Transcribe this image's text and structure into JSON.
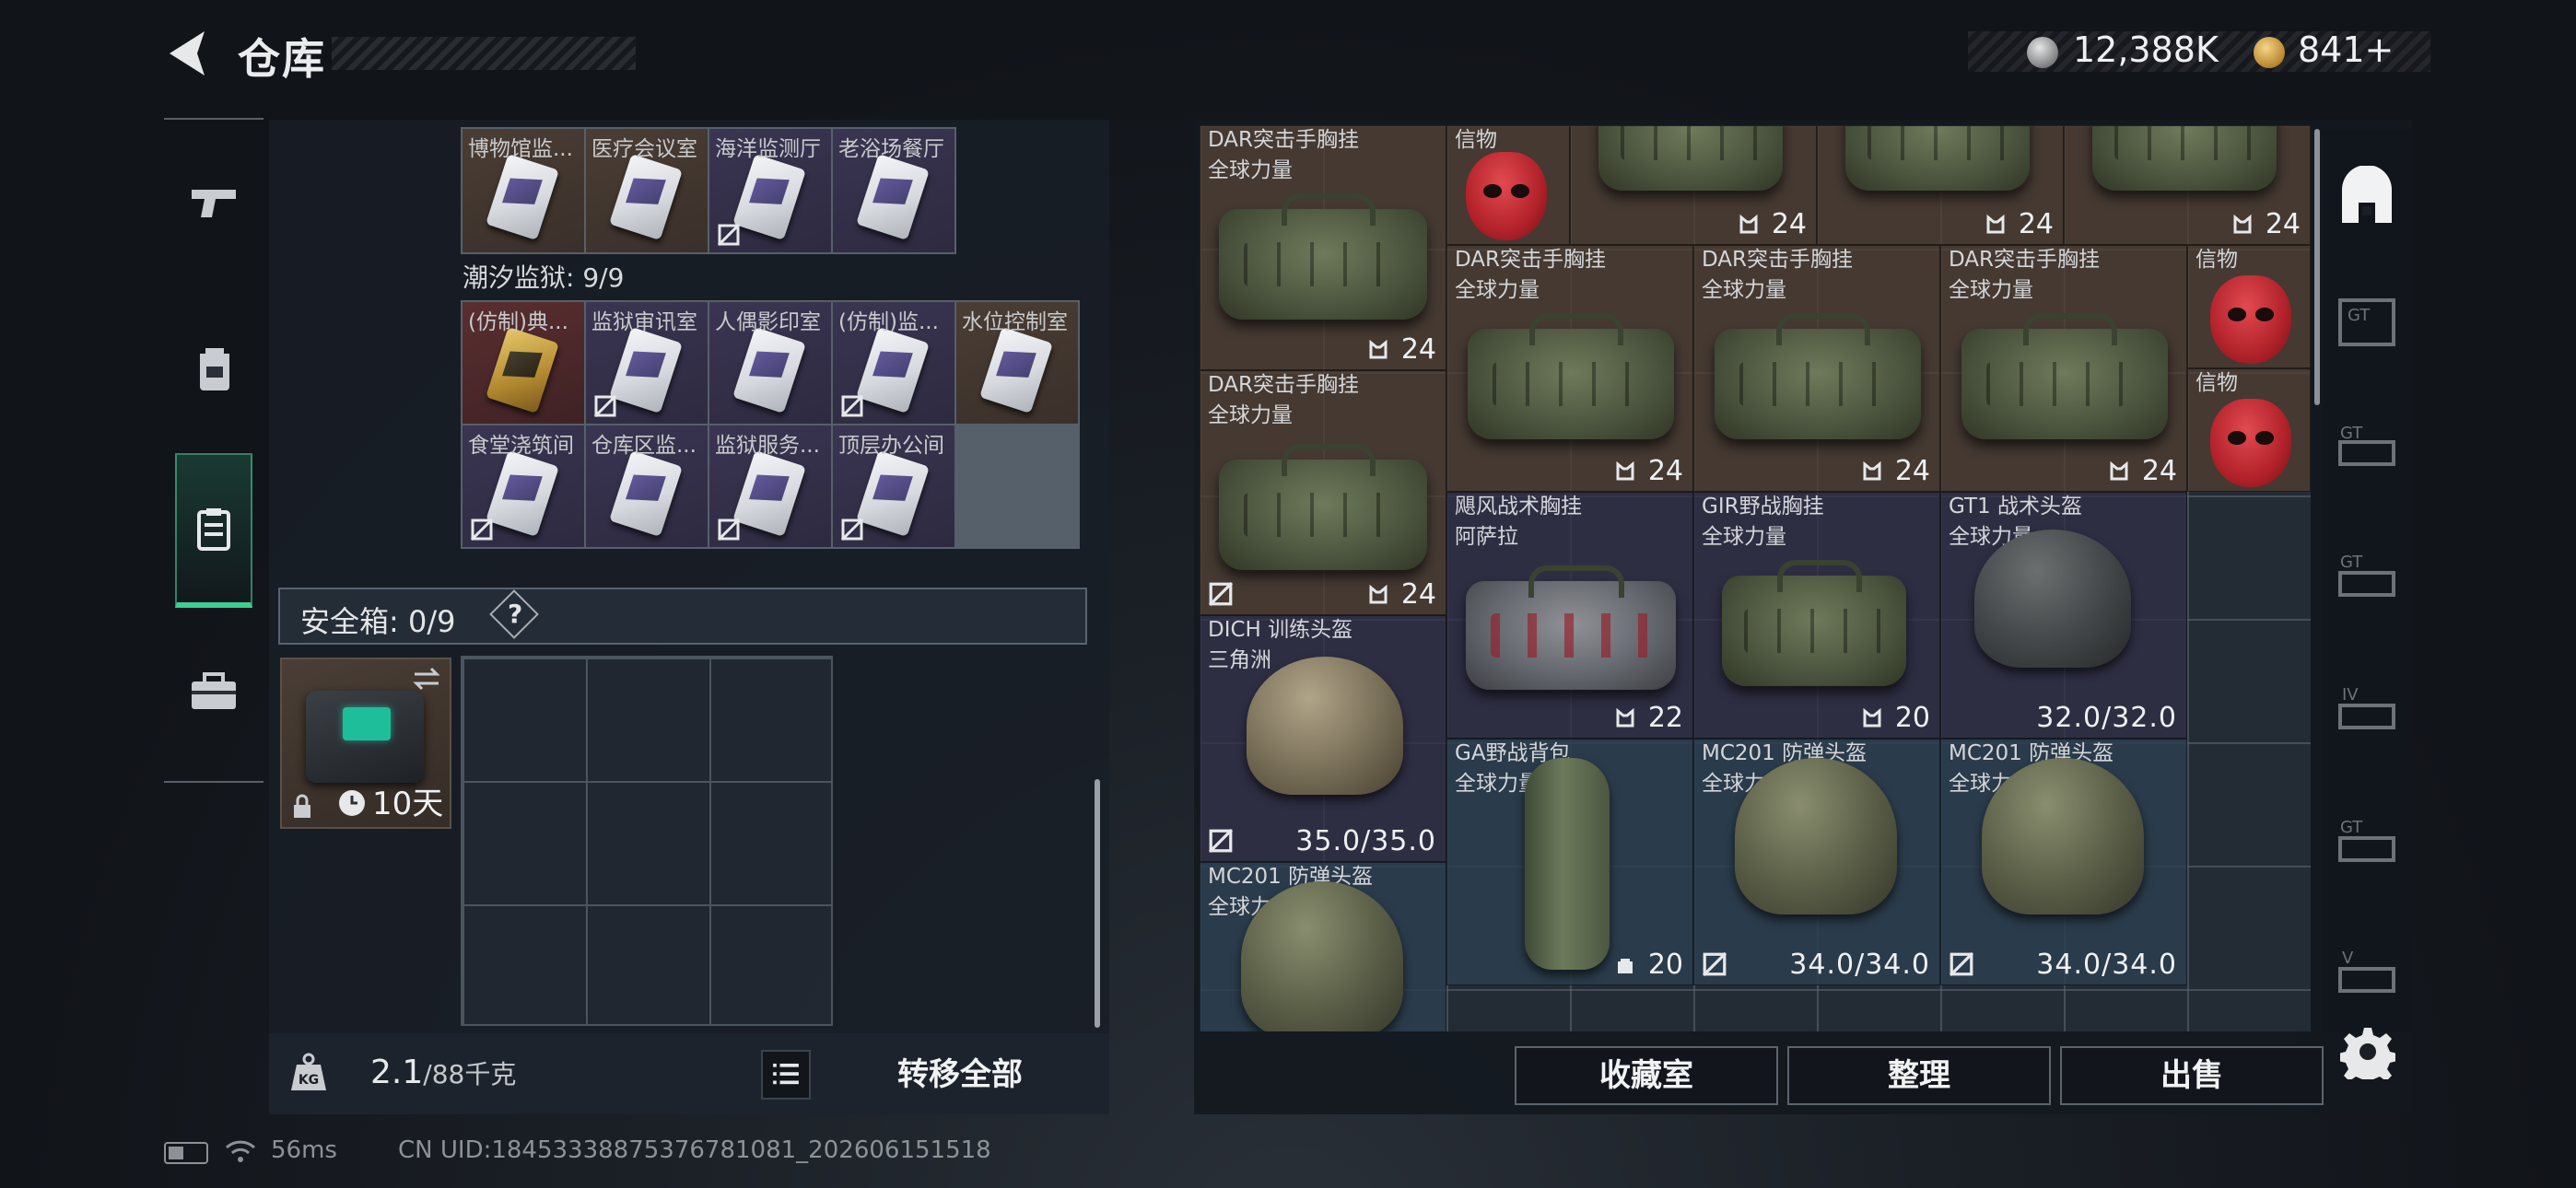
{
  "header": {
    "title": "仓库",
    "currency_silver": "12,388K",
    "currency_gold": "841+"
  },
  "left_rail": {
    "items": [
      {
        "name": "weapons",
        "icon": "pistol-icon"
      },
      {
        "name": "equipment",
        "icon": "backpack-icon"
      },
      {
        "name": "keycards",
        "icon": "keycard-icon",
        "active": true
      },
      {
        "name": "items",
        "icon": "toolbox-icon"
      }
    ]
  },
  "keycards": {
    "row_top": [
      "博物馆监...",
      "医疗会议室",
      "海洋监测厅",
      "老浴场餐厅"
    ],
    "section_title": "潮汐监狱: 9/9",
    "row_1": [
      "(仿制)典...",
      "监狱审讯室",
      "人偶影印室",
      "(仿制)监...",
      "水位控制室"
    ],
    "row_2": [
      "食堂浇筑间",
      "仓库区监...",
      "监狱服务...",
      "顶层办公间"
    ]
  },
  "safebox": {
    "label": "安全箱: 0/9",
    "help": "?",
    "days": "10天"
  },
  "bottom_left": {
    "weight_value": "2.1",
    "weight_capacity": "/88千克",
    "transfer_label": "转移全部"
  },
  "stash": {
    "items": [
      {
        "name": "DAR突击手胸挂",
        "sub": "全球力量",
        "count": "24"
      },
      {
        "name": "信物",
        "sub": "",
        "count": ""
      },
      {
        "name": "",
        "sub": "",
        "count": "24"
      },
      {
        "name": "",
        "sub": "",
        "count": "24"
      },
      {
        "name": "",
        "sub": "",
        "count": "24"
      },
      {
        "name": "DAR突击手胸挂",
        "sub": "全球力量",
        "count": "24"
      },
      {
        "name": "DAR突击手胸挂",
        "sub": "全球力量",
        "count": "24"
      },
      {
        "name": "DAR突击手胸挂",
        "sub": "全球力量",
        "count": "24"
      },
      {
        "name": "信物",
        "sub": "",
        "count": ""
      },
      {
        "name": "DAR突击手胸挂",
        "sub": "全球力量",
        "count": "24"
      },
      {
        "name": "信物",
        "sub": "",
        "count": ""
      },
      {
        "name": "飓风战术胸挂",
        "sub": "阿萨拉",
        "count": "22"
      },
      {
        "name": "GIR野战胸挂",
        "sub": "全球力量",
        "count": "20"
      },
      {
        "name": "GT1 战术头盔",
        "sub": "全球力量",
        "durability": "32.0/32.0"
      },
      {
        "name": "DICH 训练头盔",
        "sub": "三角洲",
        "durability": "35.0/35.0"
      },
      {
        "name": "GA野战背包",
        "sub": "全球力量",
        "count": "20"
      },
      {
        "name": "MC201 防弹头盔",
        "sub": "全球力量",
        "durability": "34.0/34.0"
      },
      {
        "name": "MC201 防弹头盔",
        "sub": "全球力量",
        "durability": "34.0/34.0"
      },
      {
        "name": "MC201 防弹头盔",
        "sub": "全球力量",
        "durability": ""
      }
    ]
  },
  "actions": {
    "collection": "收藏室",
    "organize": "整理",
    "sell": "出售"
  },
  "right_rail": {
    "items": [
      "home-icon",
      "gt1-icon",
      "gt1-icon",
      "gt1-icon",
      "iv-icon",
      "gt1-icon",
      "v-icon"
    ]
  },
  "status": {
    "ping": "56ms",
    "uid": "CN UID:1845333887537678108​1_202606151518"
  }
}
